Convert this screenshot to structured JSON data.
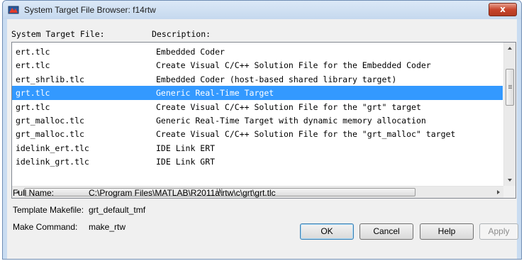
{
  "window": {
    "title": "System Target File Browser: f14rtw",
    "close_label": "x"
  },
  "columns": {
    "file": "System Target File:",
    "description": "Description:"
  },
  "rows": [
    {
      "file": "ert.tlc",
      "description": "Embedded Coder"
    },
    {
      "file": "ert.tlc",
      "description": "Create Visual C/C++ Solution File for the Embedded Coder"
    },
    {
      "file": "ert_shrlib.tlc",
      "description": "Embedded Coder (host-based shared library target)"
    },
    {
      "file": "grt.tlc",
      "description": "Generic Real-Time Target"
    },
    {
      "file": "grt.tlc",
      "description": "Create Visual C/C++ Solution File for the \"grt\" target"
    },
    {
      "file": "grt_malloc.tlc",
      "description": "Generic Real-Time Target with dynamic memory allocation"
    },
    {
      "file": "grt_malloc.tlc",
      "description": "Create Visual C/C++ Solution File for the \"grt_malloc\" target"
    },
    {
      "file": "idelink_ert.tlc",
      "description": "IDE Link ERT"
    },
    {
      "file": "idelink_grt.tlc",
      "description": "IDE Link GRT"
    },
    {
      "file": "",
      "description": ""
    }
  ],
  "selected_row": 3,
  "hscroll_grip": "III",
  "details": {
    "full_name_label": "Full Name:",
    "full_name_value": "C:\\Program Files\\MATLAB\\R2011a\\rtw\\c\\grt\\grt.tlc",
    "template_label": "Template Makefile:",
    "template_value": "grt_default_tmf",
    "make_label": "Make Command:",
    "make_value": "make_rtw"
  },
  "buttons": {
    "ok": "OK",
    "cancel": "Cancel",
    "help": "Help",
    "apply": "Apply"
  },
  "colors": {
    "selection": "#3399ff",
    "title_bar": "#c9dcf1",
    "close_button": "#c7452c"
  }
}
